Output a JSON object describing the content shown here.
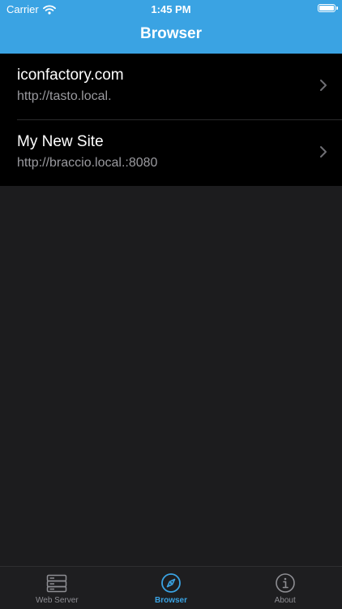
{
  "status_bar": {
    "carrier": "Carrier",
    "time": "1:45 PM",
    "icons": [
      "wifi-icon",
      "battery-icon"
    ]
  },
  "nav": {
    "title": "Browser"
  },
  "sites": [
    {
      "name": "iconfactory.com",
      "url": "http://tasto.local."
    },
    {
      "name": "My New Site",
      "url": "http://braccio.local.:8080"
    }
  ],
  "tabs": [
    {
      "label": "Web Server",
      "icon": "server-icon",
      "selected": false
    },
    {
      "label": "Browser",
      "icon": "compass-icon",
      "selected": true
    },
    {
      "label": "About",
      "icon": "info-icon",
      "selected": false
    }
  ],
  "colors": {
    "accent": "#3aa3e3",
    "background": "#1c1c1e",
    "list_background": "#000000",
    "secondary_text": "#9a9a9f",
    "inactive_tab": "#8e8e93"
  }
}
